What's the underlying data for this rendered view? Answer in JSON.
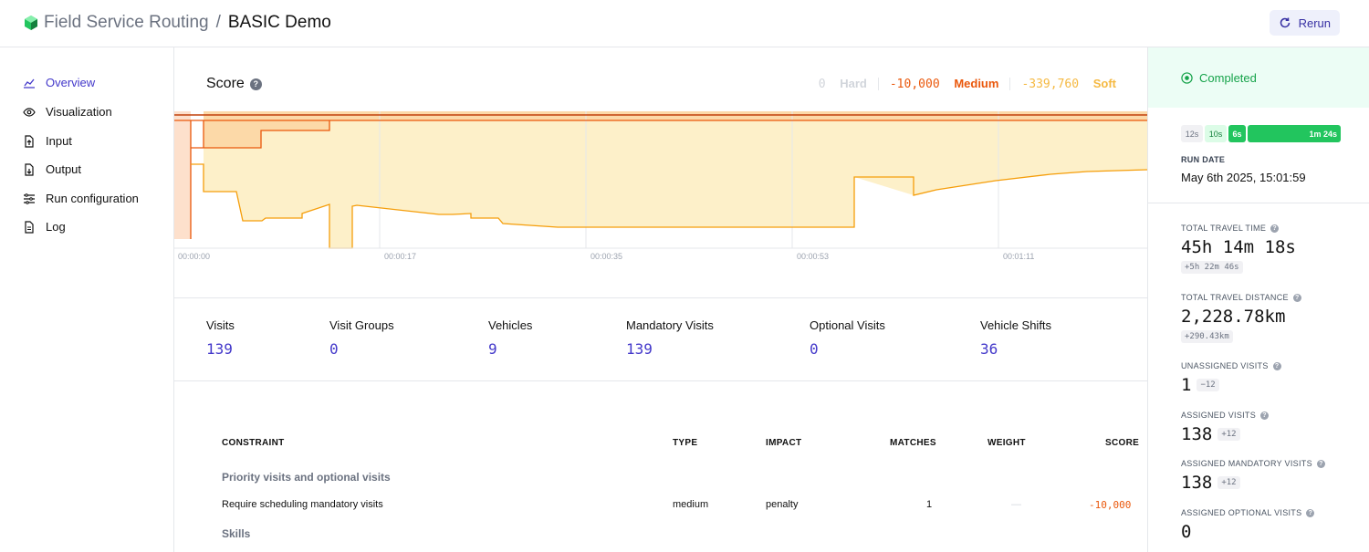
{
  "header": {
    "app_name": "Field Service Routing",
    "separator": "/",
    "project": "BASIC Demo",
    "rerun_label": "Rerun"
  },
  "sidebar": {
    "items": [
      {
        "label": "Overview",
        "icon": "chart-area-icon",
        "active": true
      },
      {
        "label": "Visualization",
        "icon": "eye-icon"
      },
      {
        "label": "Input",
        "icon": "file-upload-icon"
      },
      {
        "label": "Output",
        "icon": "file-download-icon"
      },
      {
        "label": "Run configuration",
        "icon": "sliders-icon"
      },
      {
        "label": "Log",
        "icon": "document-icon"
      }
    ]
  },
  "score": {
    "title": "Score",
    "hard_value": "0",
    "hard_label": "Hard",
    "medium_value": "-10,000",
    "medium_label": "Medium",
    "soft_value": "-339,760",
    "soft_label": "Soft"
  },
  "chart_data": {
    "type": "area",
    "x_tick_labels": [
      "00:00:00",
      "00:00:17",
      "00:00:35",
      "00:00:53",
      "00:01:11"
    ],
    "grid": true,
    "legend": "top-right",
    "series": [
      {
        "name": "Hard",
        "color": "#e5e7eb"
      },
      {
        "name": "Medium",
        "color": "#ea580c"
      },
      {
        "name": "Soft",
        "color": "#f5b942"
      }
    ]
  },
  "stats": [
    {
      "label": "Visits",
      "value": "139"
    },
    {
      "label": "Visit Groups",
      "value": "0"
    },
    {
      "label": "Vehicles",
      "value": "9"
    },
    {
      "label": "Mandatory Visits",
      "value": "139"
    },
    {
      "label": "Optional Visits",
      "value": "0"
    },
    {
      "label": "Vehicle Shifts",
      "value": "36"
    }
  ],
  "constraints": {
    "headers": {
      "constraint": "CONSTRAINT",
      "type": "TYPE",
      "impact": "IMPACT",
      "matches": "MATCHES",
      "weight": "WEIGHT",
      "score": "SCORE"
    },
    "group1": "Priority visits and optional visits",
    "row1": {
      "constraint": "Require scheduling mandatory visits",
      "type": "medium",
      "impact": "penalty",
      "matches": "1",
      "weight": "—",
      "score": "-10,000"
    },
    "group2": "Skills"
  },
  "run": {
    "status": "Completed",
    "timeline": [
      "12s",
      "10s",
      "6s",
      "1m 24s"
    ],
    "run_date_label": "RUN DATE",
    "run_date": "May 6th 2025, 15:01:59"
  },
  "metrics": [
    {
      "label": "TOTAL TRAVEL TIME",
      "value": "45h 14m 18s",
      "badge": "+5h 22m 46s"
    },
    {
      "label": "TOTAL TRAVEL DISTANCE",
      "value": "2,228.78km",
      "badge": "+290.43km"
    },
    {
      "label": "UNASSIGNED VISITS",
      "value": "1",
      "badge": "−12"
    },
    {
      "label": "ASSIGNED VISITS",
      "value": "138",
      "badge": "+12"
    },
    {
      "label": "ASSIGNED MANDATORY VISITS",
      "value": "138",
      "badge": "+12"
    },
    {
      "label": "ASSIGNED OPTIONAL VISITS",
      "value": "0",
      "badge": ""
    }
  ],
  "colors": {
    "accent": "#4338ca",
    "medium": "#ea580c",
    "soft": "#f5b942",
    "success": "#16a34a"
  }
}
